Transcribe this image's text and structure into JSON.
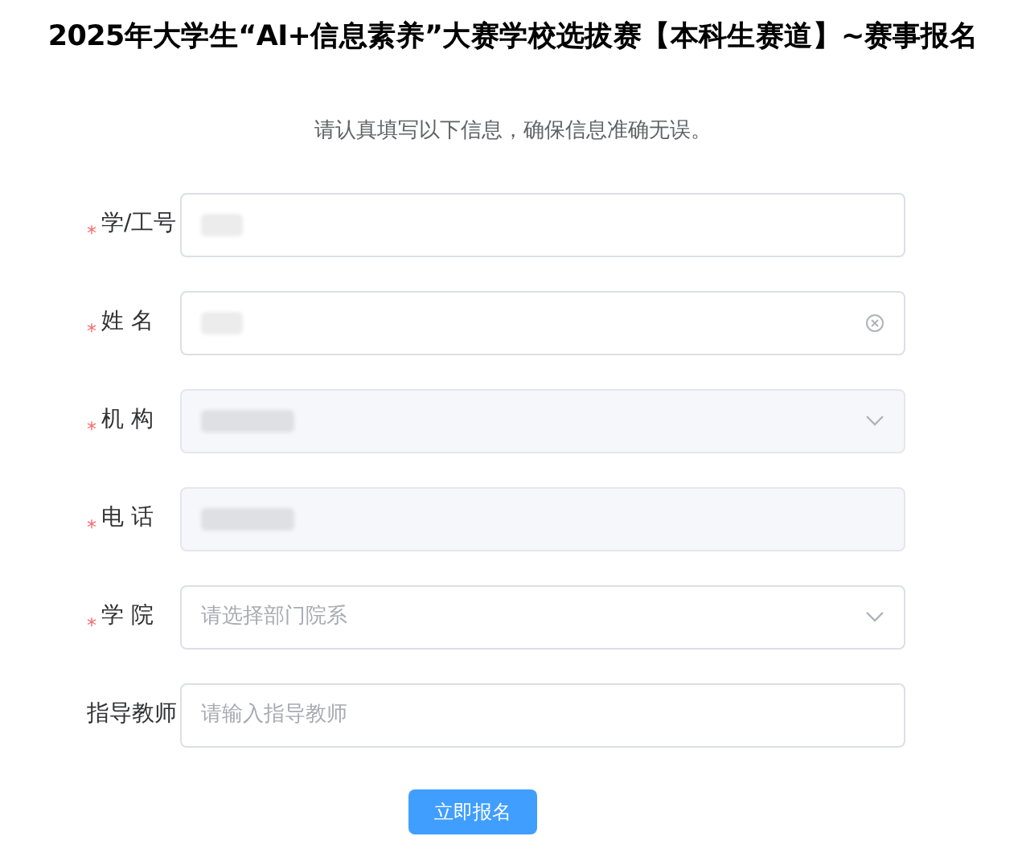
{
  "title": "2025年大学生“AI+信息素养”大赛学校选拔赛【本科生赛道】~赛事报名",
  "subtitle": "请认真填写以下信息，确保信息准确无误。",
  "fields": [
    {
      "label": "学/工号",
      "mark": "*",
      "kind": "input",
      "disabled": false,
      "redacted": true,
      "clearable": false
    },
    {
      "label": "姓 名",
      "mark": "*",
      "kind": "input",
      "disabled": false,
      "redacted": true,
      "clearable": true
    },
    {
      "label": "机 构",
      "mark": "*",
      "kind": "select",
      "disabled": true,
      "redacted": true,
      "clearable": false
    },
    {
      "label": "电 话",
      "mark": "*",
      "kind": "input",
      "disabled": true,
      "redacted": true,
      "clearable": false
    },
    {
      "label": "学 院",
      "mark": "*",
      "kind": "select",
      "disabled": false,
      "redacted": false,
      "clearable": false,
      "placeholder": "请选择部门院系"
    },
    {
      "label": "指导教师",
      "kind": "input",
      "disabled": false,
      "redacted": false,
      "clearable": false,
      "placeholder": "请输入指导教师"
    }
  ],
  "submit": "立即报名"
}
